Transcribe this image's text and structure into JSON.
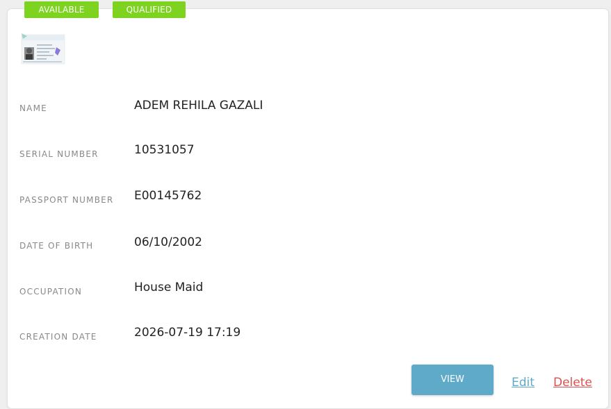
{
  "badges": {
    "available": "AVAILABLE",
    "qualified": "QUALIFIED"
  },
  "thumbnail": {
    "icon": "passport-thumbnail"
  },
  "fields": [
    {
      "label": "NAME",
      "value": "ADEM REHILA GAZALI"
    },
    {
      "label": "SERIAL NUMBER",
      "value": "10531057"
    },
    {
      "label": "PASSPORT NUMBER",
      "value": "E00145762"
    },
    {
      "label": "DATE OF BIRTH",
      "value": "06/10/2002"
    },
    {
      "label": "OCCUPATION",
      "value": "House Maid"
    },
    {
      "label": "CREATION DATE",
      "value": "2026-07-19 17:19"
    }
  ],
  "actions": {
    "view_label": "VIEW",
    "edit_label": "Edit",
    "delete_label": "Delete"
  },
  "colors": {
    "badge": "#7ed321",
    "view_button": "#5fa9c9",
    "edit_link": "#5fa9c9",
    "delete_link": "#d9534f"
  }
}
